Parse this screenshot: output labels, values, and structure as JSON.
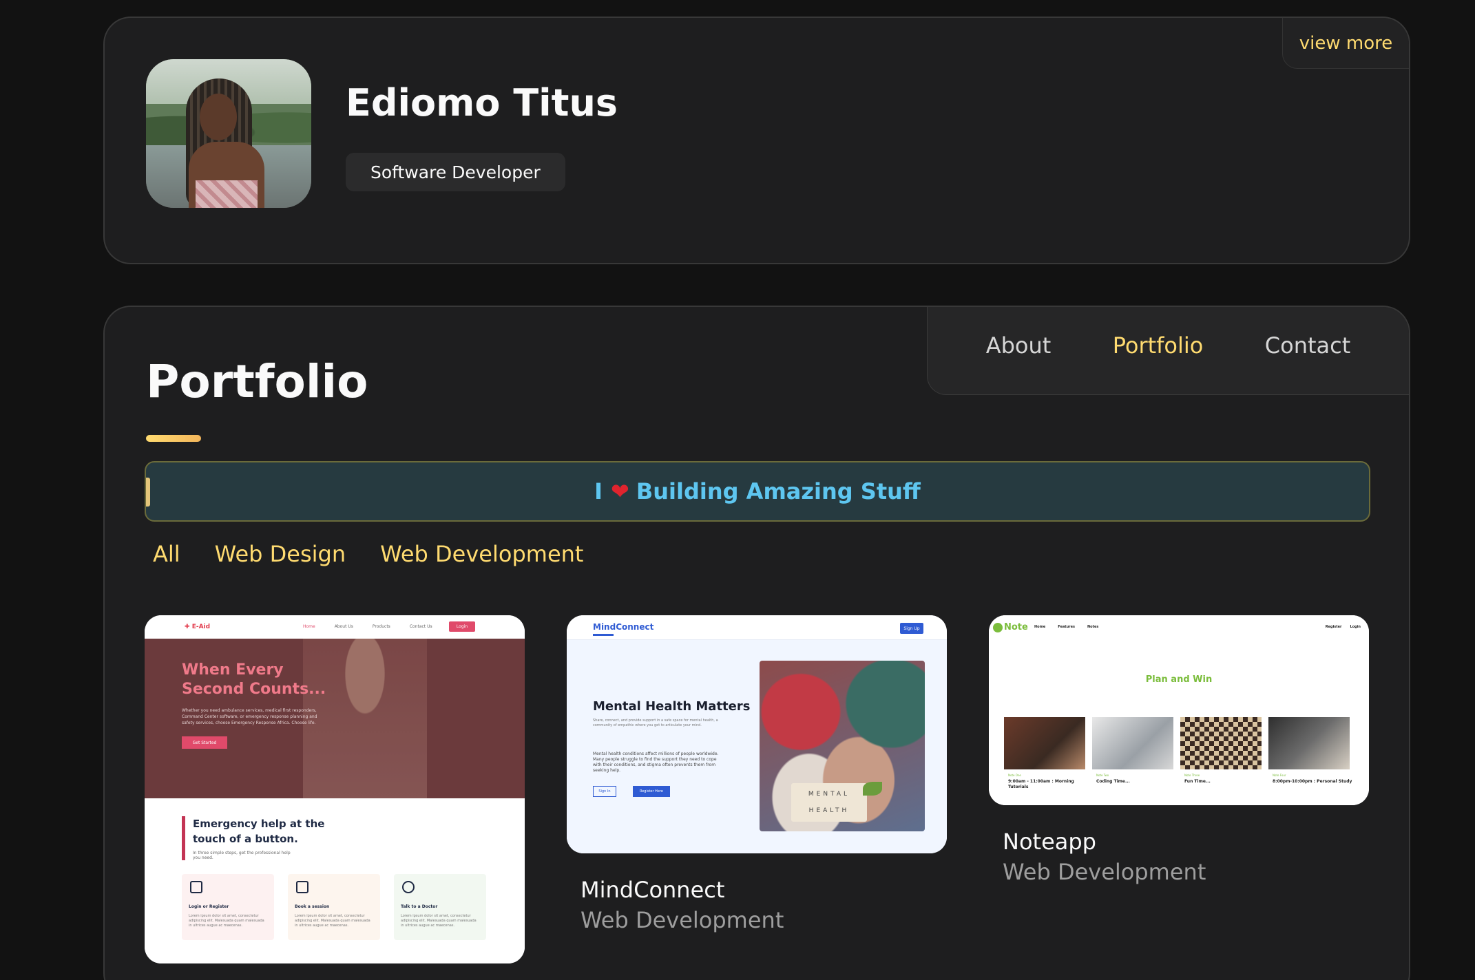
{
  "profile": {
    "name": "Ediomo Titus",
    "title": "Software Developer",
    "view_more": "view more"
  },
  "navbar": {
    "items": [
      {
        "label": "About",
        "active": false
      },
      {
        "label": "Portfolio",
        "active": true
      },
      {
        "label": "Contact",
        "active": false
      }
    ]
  },
  "portfolio": {
    "title": "Portfolio",
    "banner": {
      "prefix": "I",
      "suffix": "Building Amazing Stuff"
    },
    "filters": [
      "All",
      "Web Design",
      "Web Development"
    ],
    "projects": [
      {
        "name": "",
        "category": "",
        "preview": {
          "logo": "E-Aid",
          "nav": [
            "Home",
            "About Us",
            "Products",
            "Contact Us"
          ],
          "login": "Login",
          "headline": "When Every Second Counts...",
          "text": "Whether you need ambulance services, medical first responders, Command Center software, or emergency response planning and safety services, choose Emergency Response Africa. Choose life.",
          "button": "Get Started",
          "subheadline": "Emergency help at the touch of a button.",
          "subtext": "In three simple steps, get the professional help you need.",
          "tiles": [
            {
              "title": "Login or Register",
              "text": "Lorem ipsum dolor sit amet, consectetur adipiscing elit. Malesuada quam malesuada in ultrices augue ac maecenas."
            },
            {
              "title": "Book a session",
              "text": "Lorem ipsum dolor sit amet, consectetur adipiscing elit. Malesuada quam malesuada in ultrices augue ac maecenas."
            },
            {
              "title": "Talk to a Doctor",
              "text": "Lorem ipsum dolor sit amet, consectetur adipiscing elit. Malesuada quam malesuada in ultrices augue ac maecenas."
            }
          ]
        }
      },
      {
        "name": "MindConnect",
        "category": "Web Development",
        "preview": {
          "logo": "MindConnect",
          "signup": "Sign Up",
          "headline": "Mental Health Matters",
          "text": "Share, connect, and provide support in a safe space for mental health, a community of empathic where you get to articulate your mind.",
          "text2": "Mental health conditions affect millions of people worldwide. Many people struggle to find the support they need to cope with their conditions, and stigma often prevents them from seeking help.",
          "sign_in": "Sign In",
          "register": "Register Here",
          "sign_top": "MENTAL",
          "sign_bottom": "HEALTH"
        }
      },
      {
        "name": "Noteapp",
        "category": "Web Development",
        "preview": {
          "logo": "Note",
          "nav": [
            "Home",
            "Features",
            "Notes"
          ],
          "right": [
            "Register",
            "Login"
          ],
          "headline": "Plan and Win",
          "notes": [
            {
              "label": "Note One",
              "time": "9:00am - 11:00am : Morning Tutorials"
            },
            {
              "label": "Note Two",
              "time": "Coding Time..."
            },
            {
              "label": "Note Three",
              "time": "Fun Time..."
            },
            {
              "label": "Note Four",
              "time": "8:00pm-10:00pm : Personal Study"
            }
          ]
        }
      }
    ]
  },
  "colors": {
    "accent": "#ffdb70",
    "banner_text": "#5ec6f0",
    "background": "#121212",
    "card": "#1e1e1f"
  }
}
